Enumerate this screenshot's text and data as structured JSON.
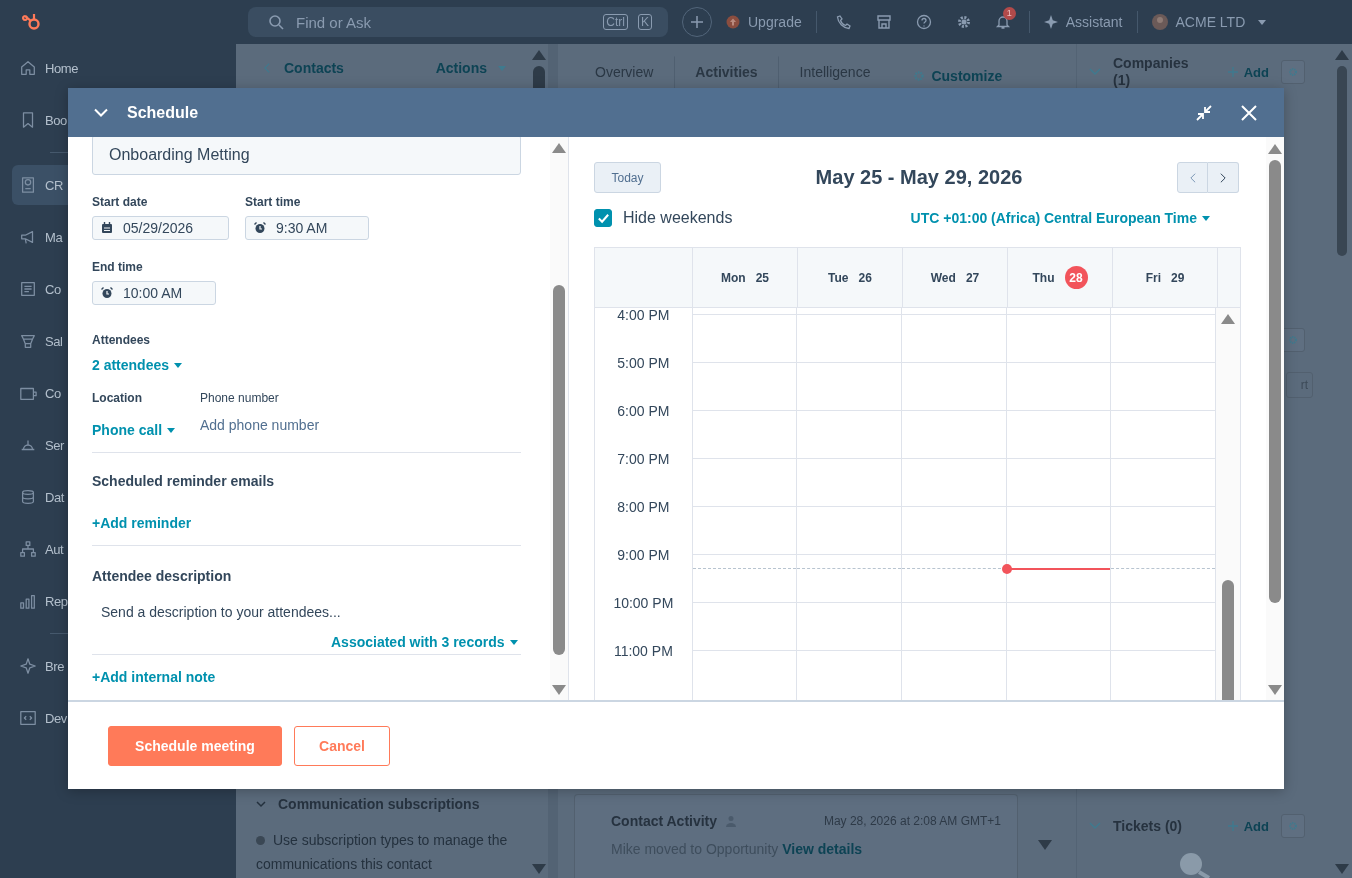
{
  "topbar": {
    "search_placeholder": "Find or Ask",
    "shortcut_keys": [
      "Ctrl",
      "K"
    ],
    "upgrade": "Upgrade",
    "notification_count": "1",
    "assistant": "Assistant",
    "account": "ACME LTD"
  },
  "sidebar": {
    "items": [
      {
        "label": "Home",
        "selected": false
      },
      {
        "label": "Boo",
        "selected": false
      },
      {
        "label": "CR",
        "selected": true
      },
      {
        "label": "Ma",
        "selected": false
      },
      {
        "label": "Co",
        "selected": false
      },
      {
        "label": "Sal",
        "selected": false
      },
      {
        "label": "Co",
        "selected": false
      },
      {
        "label": "Ser",
        "selected": false
      },
      {
        "label": "Dat",
        "selected": false
      },
      {
        "label": "Aut",
        "selected": false
      },
      {
        "label": "Rep",
        "selected": false
      },
      {
        "label": "Bre",
        "selected": false
      },
      {
        "label": "Dev",
        "selected": false
      }
    ]
  },
  "record_panel": {
    "back": "Contacts",
    "actions": "Actions",
    "section": "Communication subscriptions",
    "text": "Use subscription types to manage the communications this contact"
  },
  "middle": {
    "tabs": [
      {
        "label": "Overview",
        "selected": false
      },
      {
        "label": "Activities",
        "selected": true
      },
      {
        "label": "Intelligence",
        "selected": false
      }
    ],
    "customize": "Customize",
    "activity": {
      "title": "Contact Activity",
      "time": "May 28, 2026 at 2:08 AM GMT+1",
      "text": "Mike moved to Opportunity",
      "link": "View details"
    }
  },
  "right_panel": {
    "companies": {
      "title": "Companies (1)",
      "add": "Add"
    },
    "fragment": "rt",
    "tickets": {
      "title": "Tickets (0)",
      "add": "Add"
    }
  },
  "modal": {
    "title": "Schedule",
    "form": {
      "title_value": "Onboarding Metting",
      "start_date": {
        "label": "Start date",
        "value": "05/29/2026"
      },
      "start_time": {
        "label": "Start time",
        "value": "9:30 AM"
      },
      "end_time": {
        "label": "End time",
        "value": "10:00 AM"
      },
      "attendees": {
        "label": "Attendees",
        "value": "2 attendees"
      },
      "location": {
        "label": "Location",
        "value": "Phone call"
      },
      "phone": {
        "label": "Phone number",
        "placeholder": "Add phone number"
      },
      "reminders": {
        "heading": "Scheduled reminder emails",
        "action": "+Add reminder"
      },
      "description": {
        "heading": "Attendee description",
        "placeholder": "Send a description to your attendees...",
        "association": "Associated with 3 records"
      },
      "internal_note": "+Add internal note"
    },
    "calendar": {
      "today": "Today",
      "range": "May 25 - May 29, 2026",
      "hide_weekends": {
        "label": "Hide weekends",
        "checked": true
      },
      "timezone": "UTC +01:00 (Africa) Central European Time",
      "days": [
        {
          "name": "Mon",
          "date": "25",
          "today": false
        },
        {
          "name": "Tue",
          "date": "26",
          "today": false
        },
        {
          "name": "Wed",
          "date": "27",
          "today": false
        },
        {
          "name": "Thu",
          "date": "28",
          "today": true
        },
        {
          "name": "Fri",
          "date": "29",
          "today": false
        }
      ],
      "hours": [
        "4:00 PM",
        "5:00 PM",
        "6:00 PM",
        "7:00 PM",
        "8:00 PM",
        "9:00 PM",
        "10:00 PM",
        "11:00 PM"
      ]
    },
    "buttons": [
      {
        "label": "Schedule meeting",
        "kind": "primary"
      },
      {
        "label": "Cancel",
        "kind": "secondary"
      }
    ]
  }
}
